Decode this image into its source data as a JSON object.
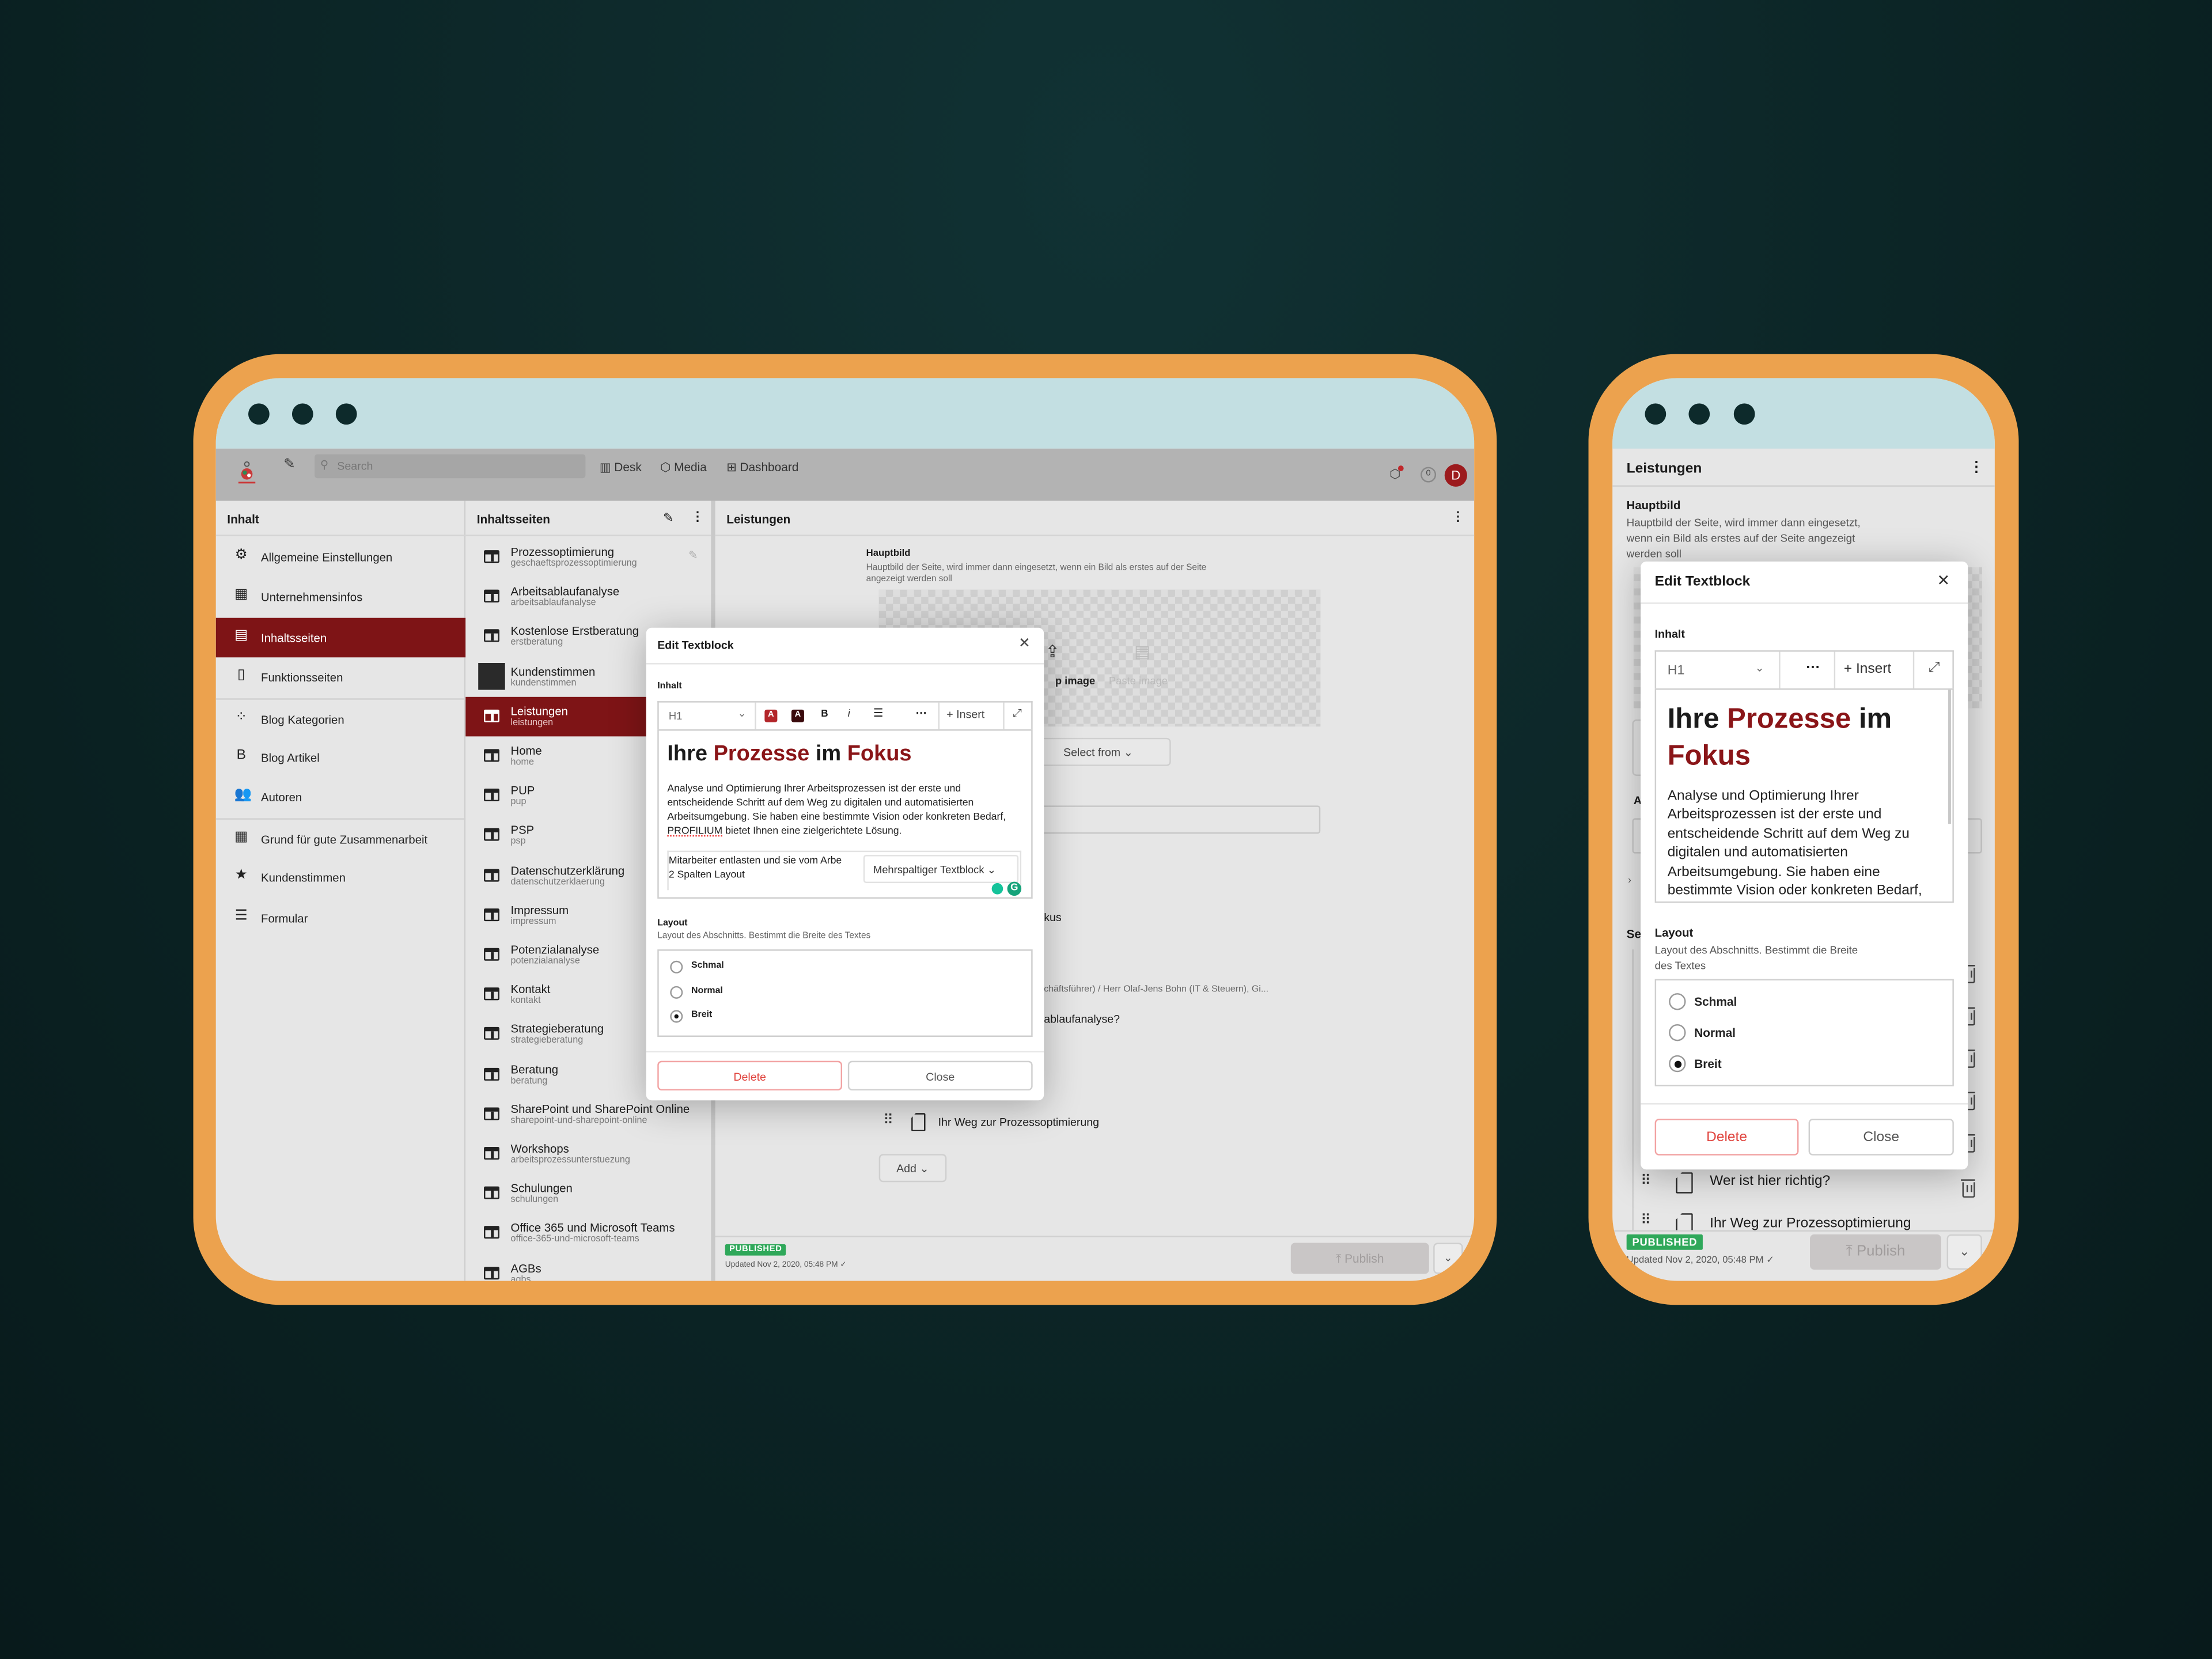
{
  "colors": {
    "background": "#0b2324",
    "frame": "#eca24e",
    "titlebar": "#c3dfe2",
    "accent": "#7e1416",
    "published": "#2fa85a",
    "delete": "#e0443e"
  },
  "topbar": {
    "search_placeholder": "Search",
    "nav": [
      {
        "label": "Desk",
        "icon": "desk-icon"
      },
      {
        "label": "Media",
        "icon": "media-icon"
      },
      {
        "label": "Dashboard",
        "icon": "dashboard-icon"
      }
    ],
    "notification_count": "0",
    "avatar_initial": "D"
  },
  "sidebar": {
    "title": "Inhalt",
    "selected": "Inhaltsseiten",
    "items": [
      {
        "label": "Allgemeine Einstellungen",
        "icon": "gear-icon"
      },
      {
        "label": "Unternehmensinfos",
        "icon": "building-icon"
      },
      {
        "label": "Inhaltsseiten",
        "icon": "page-icon"
      },
      {
        "label": "Funktionsseiten",
        "icon": "document-icon"
      },
      {
        "label": "Blog Kategorien",
        "icon": "grid-icon"
      },
      {
        "label": "Blog Artikel",
        "icon": "blogger-icon"
      },
      {
        "label": "Autoren",
        "icon": "people-icon"
      },
      {
        "label": "Grund für gute Zusammenarbeit",
        "icon": "building-icon"
      },
      {
        "label": "Kundenstimmen",
        "icon": "star-icon"
      },
      {
        "label": "Formular",
        "icon": "list-icon"
      }
    ]
  },
  "pages": {
    "title": "Inhaltsseiten",
    "selected": "Leistungen",
    "items": [
      {
        "title": "Prozessoptimierung",
        "slug": "geschaeftsprozessoptimierung"
      },
      {
        "title": "Arbeitsablaufanalyse",
        "slug": "arbeitsablaufanalyse"
      },
      {
        "title": "Kostenlose Erstberatung",
        "slug": "erstberatung"
      },
      {
        "title": "Kundenstimmen",
        "slug": "kundenstimmen"
      },
      {
        "title": "Leistungen",
        "slug": "leistungen"
      },
      {
        "title": "Home",
        "slug": "home"
      },
      {
        "title": "PUP",
        "slug": "pup"
      },
      {
        "title": "PSP",
        "slug": "psp"
      },
      {
        "title": "Datenschutzerklärung",
        "slug": "datenschutzerklaerung"
      },
      {
        "title": "Impressum",
        "slug": "impressum"
      },
      {
        "title": "Potenzialanalyse",
        "slug": "potenzialanalyse"
      },
      {
        "title": "Kontakt",
        "slug": "kontakt"
      },
      {
        "title": "Strategieberatung",
        "slug": "strategieberatung"
      },
      {
        "title": "Beratung",
        "slug": "beratung"
      },
      {
        "title": "SharePoint und SharePoint Online",
        "slug": "sharepoint-und-sharepoint-online"
      },
      {
        "title": "Workshops",
        "slug": "arbeitsprozessunterstuezung"
      },
      {
        "title": "Schulungen",
        "slug": "schulungen"
      },
      {
        "title": "Office 365 und Microsoft Teams",
        "slug": "office-365-und-microsoft-teams"
      },
      {
        "title": "AGBs",
        "slug": "agbs"
      }
    ]
  },
  "document": {
    "title": "Leistungen",
    "hauptbild_label": "Hauptbild",
    "hauptbild_desc": "Hauptbild der Seite, wird immer dann eingesetzt, wenn ein Bild als erstes auf der Seite angezeigt werden soll",
    "drop_image": "p image",
    "paste_image": "Paste image",
    "select_from": "Select from",
    "rows": [
      "kus",
      "",
      "chäftsführer) / Herr Olaf-Jens Bohn (IT & Steuern), Gi...",
      "ablaufanalyse?",
      "",
      "",
      "Ihr Weg zur Prozessoptimierung"
    ],
    "add": "Add",
    "status": "PUBLISHED",
    "updated": "Updated Nov 2, 2020, 05:48 PM",
    "publish": "Publish"
  },
  "dialog": {
    "title": "Edit Textblock",
    "content_label": "Inhalt",
    "style": "H1",
    "insert": "Insert",
    "heading": {
      "w1": "Ihre",
      "w2": "Prozesse",
      "w3": "im",
      "w4": "Fokus"
    },
    "body_pre": "Analyse und Optimierung Ihrer Arbeitsprozessen ist der erste und entscheidende Schritt auf dem Weg zu digitalen und automatisierten Arbeitsumgebung. Sie haben eine bestimmte Vision oder konkreten Bedarf, ",
    "body_brand": "PROFILIUM",
    "body_post": " bietet Ihnen eine zielgerichtete Lösung.",
    "nested_line1": "Mitarbeiter entlasten und sie vom Arbe",
    "nested_line2": "2 Spalten Layout",
    "nested_type": "Mehrspaltiger Textblock",
    "layout_label": "Layout",
    "layout_desc": "Layout des Abschnitts. Bestimmt die Breite des Textes",
    "options": [
      "Schmal",
      "Normal",
      "Breit"
    ],
    "selected": "Breit",
    "delete": "Delete",
    "close": "Close"
  },
  "mobile": {
    "title": "Leistungen",
    "hauptbild_label": "Hauptbild",
    "hauptbild_desc": "Hauptbild der Seite, wird immer dann eingesetzt, wenn ein Bild als erstes auf der Seite angezeigt werden soll",
    "partial_a": "A",
    "partial_se": "Se",
    "row1": "Wer ist hier richtig?",
    "row2": "Ihr Weg zur Prozessoptimierung",
    "status": "PUBLISHED",
    "updated": "Updated Nov 2, 2020, 05:48 PM",
    "publish": "Publish"
  }
}
